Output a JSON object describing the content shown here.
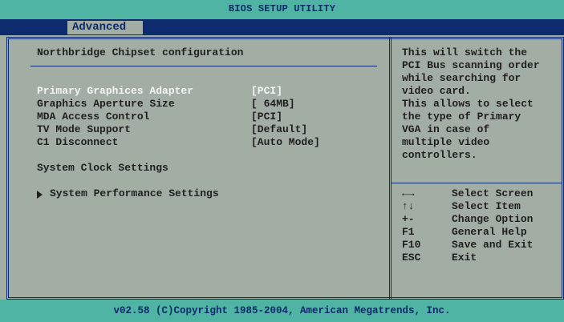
{
  "title": "BIOS SETUP UTILITY",
  "tab": "Advanced",
  "section_title": "Northbridge Chipset configuration",
  "settings": [
    {
      "label": "Primary Graphices Adapter",
      "value": "[PCI]"
    },
    {
      "label": "Graphics Aperture Size",
      "value": "[ 64MB]"
    },
    {
      "label": "MDA Access Control",
      "value": "[PCI]"
    },
    {
      "label": "TV Mode Support",
      "value": "[Default]"
    },
    {
      "label": "C1 Disconnect",
      "value": "[Auto Mode]"
    }
  ],
  "clock_label": "System Clock Settings",
  "submenu": "System Performance Settings",
  "help_lines": [
    "This will switch the",
    "PCI Bus scanning order",
    "while searching for",
    "video card.",
    "This allows to select",
    "the type of Primary",
    "VGA in case of",
    "multiple video",
    "controllers."
  ],
  "keys": [
    {
      "key": "←→",
      "desc": "Select Screen"
    },
    {
      "key": "↑↓",
      "desc": "Select Item"
    },
    {
      "key": "+-",
      "desc": "Change Option"
    },
    {
      "key": "F1",
      "desc": "General Help"
    },
    {
      "key": "F10",
      "desc": "Save and Exit"
    },
    {
      "key": "ESC",
      "desc": "Exit"
    }
  ],
  "copyright": "v02.58 (C)Copyright 1985-2004, American Megatrends, Inc."
}
